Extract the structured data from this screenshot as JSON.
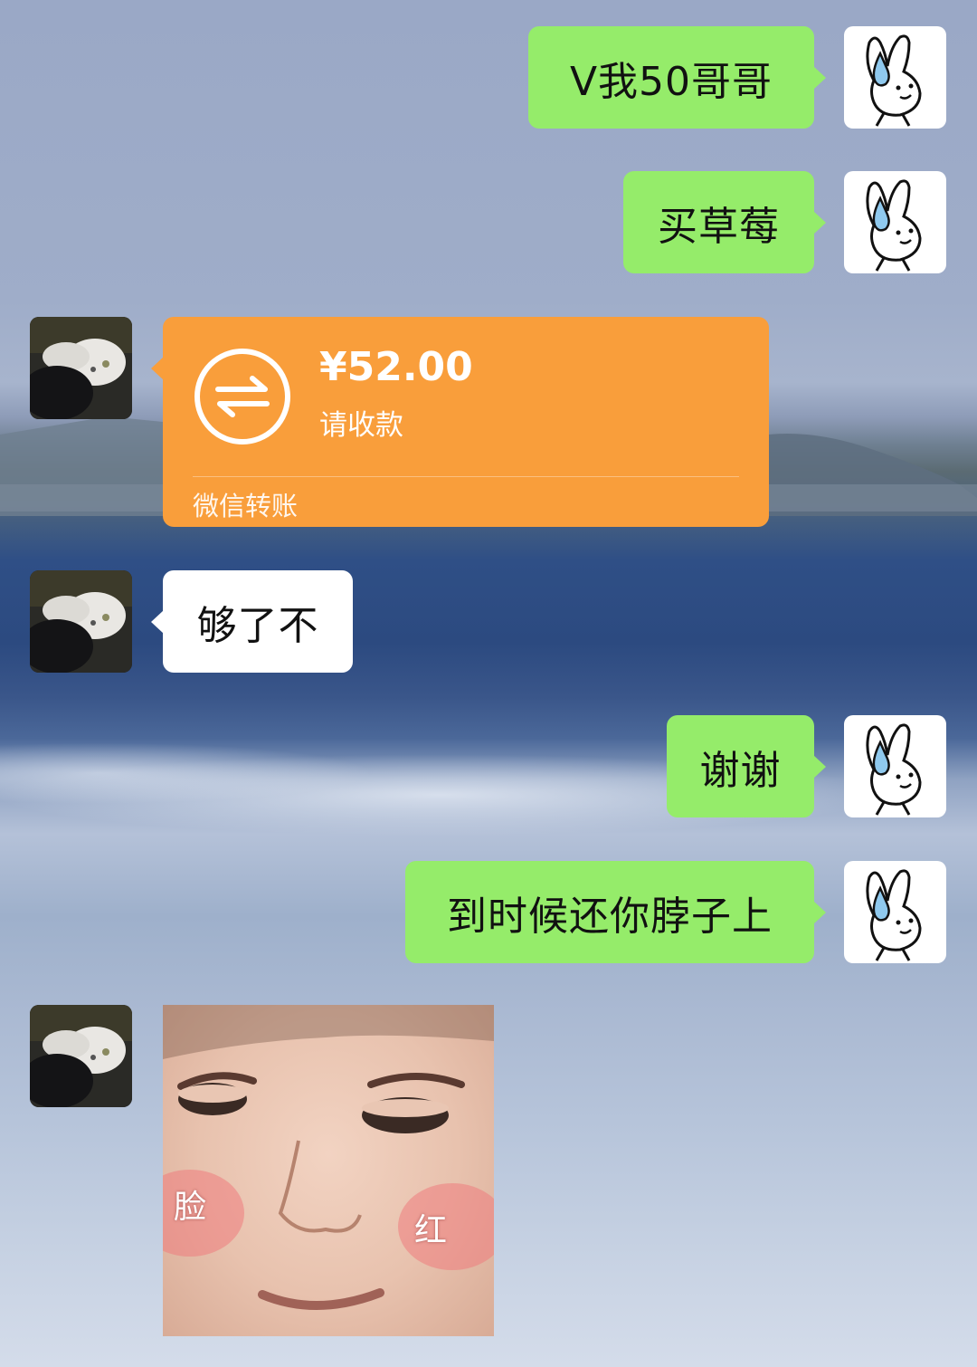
{
  "messages": [
    {
      "sender": "me",
      "type": "text",
      "text": "V我50哥哥"
    },
    {
      "sender": "me",
      "type": "text",
      "text": "买草莓"
    },
    {
      "sender": "other",
      "type": "transfer",
      "amount": "¥52.00",
      "status": "请收款",
      "footer": "微信转账"
    },
    {
      "sender": "other",
      "type": "text",
      "text": "够了不"
    },
    {
      "sender": "me",
      "type": "text",
      "text": "谢谢"
    },
    {
      "sender": "me",
      "type": "text",
      "text": "到时候还你脖子上"
    },
    {
      "sender": "other",
      "type": "sticker",
      "sticker": {
        "label_left": "脸",
        "label_right": "红"
      }
    }
  ],
  "avatars": {
    "me": "bunny-avatar",
    "other": "cat-avatar"
  },
  "colors": {
    "my_bubble": "#95ec6a",
    "other_bubble": "#ffffff",
    "transfer_card": "#f99e3b"
  }
}
